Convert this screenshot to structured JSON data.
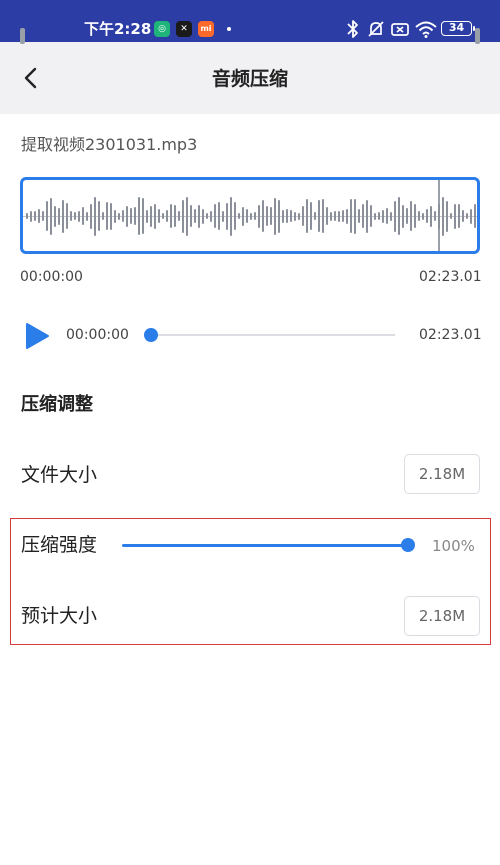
{
  "status_bar": {
    "time": "下午2:28",
    "app_icons": [
      {
        "name": "shield-app-icon",
        "color": "#1fb57a",
        "glyph": "◎"
      },
      {
        "name": "capcut-app-icon",
        "color": "#1a1a1a",
        "glyph": "✕"
      },
      {
        "name": "mi-app-icon",
        "color": "#ff6a2b",
        "glyph": "mi"
      }
    ],
    "battery": "34"
  },
  "header": {
    "title": "音频压缩"
  },
  "audio": {
    "file_name": "提取视频2301031.mp3",
    "range_start": "00:00:00",
    "range_end": "02:23.01",
    "current_time": "00:00:00",
    "total_time": "02:23.01",
    "progress": 0
  },
  "compression": {
    "section_title": "压缩调整",
    "file_size_label": "文件大小",
    "file_size_value": "2.18M",
    "strength_label": "压缩强度",
    "strength_value": "100%",
    "strength_fraction": 1.0,
    "estimated_label": "预计大小",
    "estimated_value": "2.18M"
  },
  "colors": {
    "accent": "#2b7de9",
    "status_bar": "#2d3da6",
    "highlight": "#d93b3b"
  }
}
